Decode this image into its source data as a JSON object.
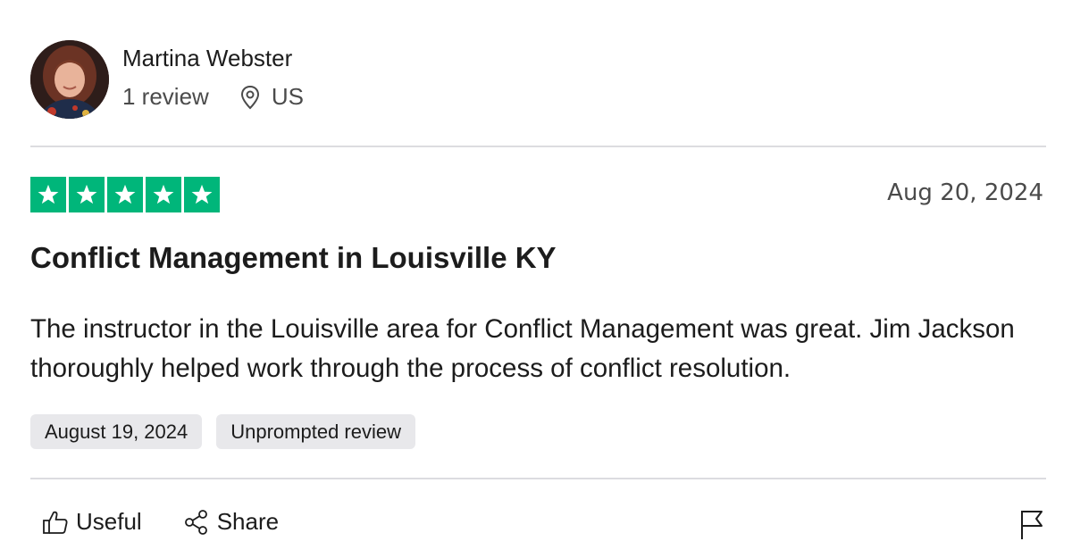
{
  "reviewer": {
    "name": "Martina Webster",
    "review_count": "1 review",
    "country": "US"
  },
  "review": {
    "rating": 5,
    "star_color": "#00b67a",
    "date": "Aug 20, 2024",
    "title": "Conflict Management in Louisville KY",
    "body": "The instructor in the Louisville area for Conflict Management was great. Jim Jackson thoroughly helped work through the process of conflict resolution.",
    "experience_date": "August 19, 2024",
    "tag": "Unprompted review"
  },
  "actions": {
    "useful_label": "Useful",
    "share_label": "Share"
  },
  "icons": {
    "location": "map-pin-icon",
    "useful": "thumbs-up-icon",
    "share": "share-icon",
    "report": "flag-icon"
  }
}
